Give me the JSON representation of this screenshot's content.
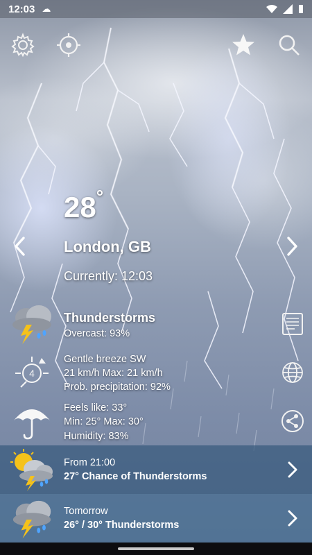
{
  "status": {
    "time": "12:03"
  },
  "main": {
    "temperature": "28",
    "degree": "°",
    "city": "London, GB",
    "current_time": "Currently: 12:03",
    "condition": "Thunderstorms",
    "overcast": "Overcast: 93%",
    "wind_title": "Gentle breeze SW",
    "wind_speed": "21 km/h Max: 21 km/h",
    "precip": "Prob. precipitation: 92%",
    "feels_like": "Feels like: 33°",
    "minmax": "Min: 25° Max: 30°",
    "humidity": "Humidity: 83%",
    "wind_beaufort": "4"
  },
  "forecast": [
    {
      "when": "From 21:00",
      "summary": "27° Chance of Thunderstorms"
    },
    {
      "when": "Tomorrow",
      "summary": "26° / 30° Thunderstorms"
    }
  ],
  "icons": {
    "settings": "gear-icon",
    "location": "crosshair-icon",
    "favorite": "star-icon",
    "search": "search-icon",
    "details": "document-icon",
    "map": "globe-icon",
    "share": "share-icon"
  }
}
